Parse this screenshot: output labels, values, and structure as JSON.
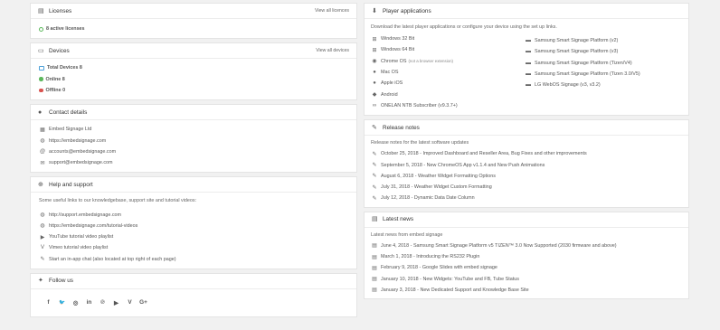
{
  "licenses": {
    "title": "Licenses",
    "link": "View all licences",
    "active": "8 active licenses"
  },
  "devices": {
    "title": "Devices",
    "link": "View all devices",
    "total": "Total Devices 8",
    "online": "Online 8",
    "offline": "Offline 0"
  },
  "contact": {
    "title": "Contact details",
    "items": [
      {
        "icon": "building-icon",
        "text": "Embed Signage Ltd"
      },
      {
        "icon": "globe-icon",
        "text": "https://embedsignage.com"
      },
      {
        "icon": "at-icon",
        "text": "accounts@embedsignage.com"
      },
      {
        "icon": "envelope-icon",
        "text": "support@embedsignage.com"
      }
    ]
  },
  "help": {
    "title": "Help and support",
    "intro": "Some useful links to our knowledgebase, support site and tutorial videos:",
    "items": [
      {
        "icon": "globe-icon",
        "text": "http://support.embedsignage.com"
      },
      {
        "icon": "globe-icon",
        "text": "https://embedsignage.com/tutorial-videos"
      },
      {
        "icon": "youtube-icon",
        "text": "YouTube tutorial video playlist"
      },
      {
        "icon": "vimeo-icon",
        "text": "Vimeo tutorial video playlist"
      },
      {
        "icon": "chat-icon",
        "text": "Start an in-app chat (also located at top right of each page)"
      }
    ]
  },
  "follow": {
    "title": "Follow us",
    "icons": [
      {
        "name": "facebook-icon",
        "glyph": "f"
      },
      {
        "name": "twitter-icon",
        "glyph": "🐦"
      },
      {
        "name": "instagram-icon",
        "glyph": "◎"
      },
      {
        "name": "linkedin-icon",
        "glyph": "in"
      },
      {
        "name": "pinterest-icon",
        "glyph": "℗"
      },
      {
        "name": "youtube-icon",
        "glyph": "▶"
      },
      {
        "name": "vimeo-icon",
        "glyph": "V"
      },
      {
        "name": "google-plus-icon",
        "glyph": "G+"
      }
    ]
  },
  "player_apps": {
    "title": "Player applications",
    "intro": "Download the latest player applications or configure your device using the set up links.",
    "left": [
      {
        "icon": "windows-icon",
        "text": "Windows 32 Bit",
        "note": ""
      },
      {
        "icon": "windows-icon",
        "text": "Windows 64 Bit",
        "note": ""
      },
      {
        "icon": "chrome-icon",
        "text": "Chrome OS",
        "note": "(not a browser extension)"
      },
      {
        "icon": "apple-icon",
        "text": "Mac OS",
        "note": ""
      },
      {
        "icon": "apple-icon",
        "text": "Apple iOS",
        "note": ""
      },
      {
        "icon": "android-icon",
        "text": "Android",
        "note": ""
      },
      {
        "icon": "link-icon",
        "text": "ONELAN NTB Subscriber (v9.3.7+)",
        "note": ""
      }
    ],
    "right": [
      {
        "icon": "tv-icon",
        "text": "Samsung Smart Signage Platform (v2)"
      },
      {
        "icon": "tv-icon",
        "text": "Samsung Smart Signage Platform (v3)"
      },
      {
        "icon": "tv-icon",
        "text": "Samsung Smart Signage Platform (Tizen/V4)"
      },
      {
        "icon": "tv-icon",
        "text": "Samsung Smart Signage Platform (Tizen 3.0/V5)"
      },
      {
        "icon": "tv-icon",
        "text": "LG WebOS Signage (v3, v3.2)"
      }
    ]
  },
  "release_notes": {
    "title": "Release notes",
    "intro": "Release notes for the latest software updates",
    "items": [
      "October 25, 2018 - Improved Dashboard and Reseller Area, Bug Fixes and other improvements",
      "September 5, 2018 - New ChromeOS App v1.1.4 and New Push Animations",
      "August 6, 2018 - Weather Widget Formatting Options",
      "July 31, 2018 - Weather Widget Custom Formatting",
      "July 12, 2018 - Dynamic Data Date Column"
    ]
  },
  "latest_news": {
    "title": "Latest news",
    "intro": "Latest news from embed signage",
    "items": [
      "June 4, 2018 - Samsung Smart Signage Platform v5 TIZEN™ 3.0 Now Supported (2030 firmware and above)",
      "March 1, 2018 - Introducing the RS232 Plugin",
      "February 9, 2018 - Google Slides with embed signage",
      "January 10, 2018 - New Widgets: YouTube and FB, Tube Status",
      "January 3, 2018 - New Dedicated Support and Knowledge Base Site"
    ]
  }
}
